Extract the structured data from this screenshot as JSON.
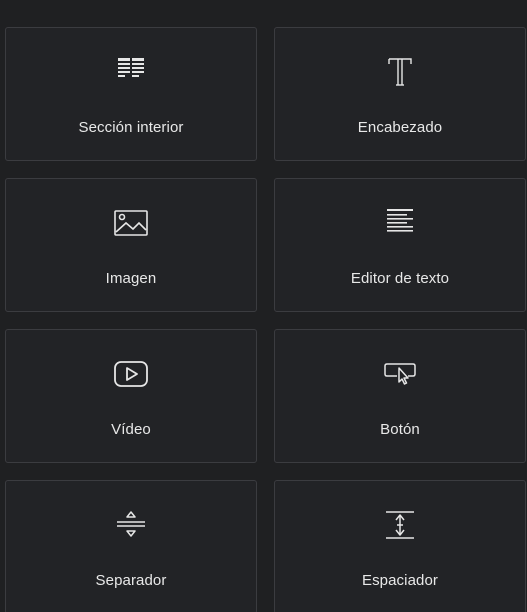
{
  "widgets": [
    {
      "label": "Sección interior",
      "icon": "inner-section-icon"
    },
    {
      "label": "Encabezado",
      "icon": "heading-icon"
    },
    {
      "label": "Imagen",
      "icon": "image-icon"
    },
    {
      "label": "Editor de texto",
      "icon": "text-editor-icon"
    },
    {
      "label": "Vídeo",
      "icon": "video-icon"
    },
    {
      "label": "Botón",
      "icon": "button-icon"
    },
    {
      "label": "Separador",
      "icon": "divider-icon"
    },
    {
      "label": "Espaciador",
      "icon": "spacer-icon"
    }
  ],
  "colors": {
    "background": "#1f2022",
    "card": "#222326",
    "border": "#3b3c40",
    "text": "#e8e8e8"
  }
}
